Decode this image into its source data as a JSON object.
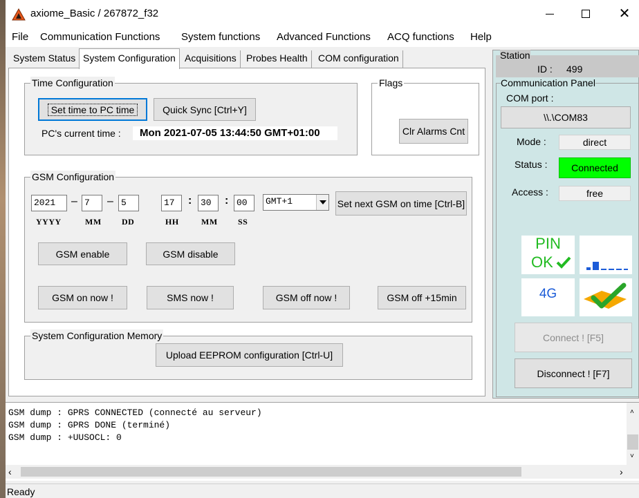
{
  "window": {
    "title": "axiome_Basic / 267872_f32",
    "min_icon": "minimize-icon",
    "max_icon": "maximize-icon",
    "close_icon": "close-icon"
  },
  "menu": [
    "File",
    "Communication Functions",
    "System functions",
    "Advanced Functions",
    "ACQ functions",
    "Help"
  ],
  "tabs": [
    "System Status",
    "System Configuration",
    "Acquisitions",
    "Probes Health",
    "COM configuration"
  ],
  "active_tab": "System Configuration",
  "time_config": {
    "title": "Time Configuration",
    "set_time_btn": "Set time to PC time",
    "quick_sync_btn": "Quick Sync [Ctrl+Y]",
    "pc_time_label": "PC's current time :",
    "pc_time_value": "Mon 2021-07-05 13:44:50 GMT+01:00"
  },
  "flags": {
    "title": "Flags",
    "clr_alarms_btn": "Clr Alarms Cnt"
  },
  "gsm_config": {
    "title": "GSM Configuration",
    "year": "2021",
    "month": "7",
    "day": "5",
    "hour": "17",
    "minute": "30",
    "second": "00",
    "date_sep": "–",
    "time_sep": ":",
    "timezone": "GMT+1",
    "set_next_btn": "Set next GSM on time [Ctrl-B]",
    "labels": {
      "yyyy": "YYYY",
      "mm": "MM",
      "dd": "DD",
      "hh": "HH",
      "min": "MM",
      "ss": "SS"
    },
    "enable_btn": "GSM enable",
    "disable_btn": "GSM disable",
    "on_now_btn": "GSM on now !",
    "sms_now_btn": "SMS now !",
    "off_now_btn": "GSM off now !",
    "off_15_btn": "GSM off +15min"
  },
  "memory": {
    "title": "System Configuration Memory",
    "upload_btn": "Upload EEPROM configuration [Ctrl-U]"
  },
  "station": {
    "title": "Station",
    "id_label": "ID :",
    "id_value": "499"
  },
  "comm_panel": {
    "title": "Communication Panel",
    "com_port_label": "COM port :",
    "com_port_value": "\\\\.\\COM83",
    "mode_label": "Mode :",
    "mode_value": "direct",
    "status_label": "Status :",
    "status_value": "Connected",
    "status_color": "#00ff00",
    "access_label": "Access :",
    "access_value": "free",
    "pin_line1": "PIN",
    "pin_line2": "OK",
    "network_label": "4G",
    "connect_btn": "Connect ! [F5]",
    "disconnect_btn": "Disconnect ! [F7]"
  },
  "log": [
    "GSM dump : GPRS CONNECTED (connecté au serveur)",
    "GSM dump : GPRS DONE (terminé)",
    "GSM dump : +UUSOCL: 0"
  ],
  "status_bar": "Ready",
  "colors": {
    "panel_bg": "#cfe6e6",
    "station_bg": "#c8c8c8",
    "pin_green": "#22bb22",
    "signal_blue": "#1c5cd8"
  }
}
